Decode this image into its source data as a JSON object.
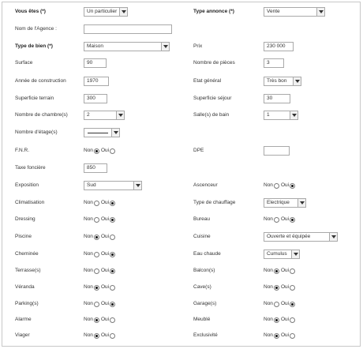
{
  "header": {
    "vous_etes_label": "Vous êtes (*)",
    "vous_etes_value": "Un particulier",
    "type_annonce_label": "Type annonce (*)",
    "type_annonce_value": "Vente"
  },
  "fields": {
    "nom_agence_label": "Nom de l'Agence :",
    "nom_agence_value": "",
    "type_bien_label": "Type de bien (*)",
    "type_bien_value": "Maison",
    "prix_label": "Prix",
    "prix_value": "230 000",
    "surface_label": "Surface",
    "surface_value": "90",
    "pieces_label": "Nombre de pièces",
    "pieces_value": "3",
    "annee_label": "Année de construction",
    "annee_value": "1970",
    "etat_label": "Etat général",
    "etat_value": "Très bon",
    "superficie_terrain_label": "Superficie terrain",
    "superficie_terrain_value": "300",
    "superficie_sejour_label": "Superficie séjour",
    "superficie_sejour_value": "30",
    "chambres_label": "Nombre de chambre(s)",
    "chambres_value": "2",
    "salle_bain_label": "Salle(s) de bain",
    "salle_bain_value": "1",
    "etages_label": "Nombre d'étage(s)",
    "fnr_label": "F.N.R.",
    "dpe_label": "DPE",
    "dpe_value": "",
    "taxe_label": "Taxe foncière",
    "taxe_value": "850",
    "exposition_label": "Exposition",
    "exposition_value": "Sud",
    "ascenceur_label": "Ascenceur",
    "climatisation_label": "Climatisation",
    "chauffage_label": "Type de chauffage",
    "chauffage_value": "Electrique",
    "dressing_label": "Dressing",
    "bureau_label": "Bureau",
    "piscine_label": "Piscine",
    "cuisine_label": "Cuisine",
    "cuisine_value": "Ouverte et équipée",
    "cheminee_label": "Cheminée",
    "eau_chaude_label": "Eau chaude",
    "eau_chaude_value": "Cumulus",
    "terrasse_label": "Terrasse(s)",
    "balcon_label": "Balcon(s)",
    "veranda_label": "Véranda",
    "cave_label": "Cave(s)",
    "parking_label": "Parking(s)",
    "garage_label": "Garage(s)",
    "alarme_label": "Alarme",
    "meuble_label": "Meublé",
    "viager_label": "Viager",
    "exclusivite_label": "Exclusivité"
  },
  "radio_labels": {
    "non": "Non",
    "oui": "Oui"
  },
  "radio_values": {
    "fnr": "non",
    "ascenceur": "oui",
    "climatisation": "oui",
    "dressing": "oui",
    "bureau": "oui",
    "piscine": "non",
    "cheminee": "oui",
    "terrasse": "oui",
    "balcon": "non",
    "veranda": "non",
    "cave": "non",
    "parking": "oui",
    "garage": "oui",
    "alarme": "non",
    "meuble": "non",
    "viager": "non",
    "exclusivite": "non"
  }
}
